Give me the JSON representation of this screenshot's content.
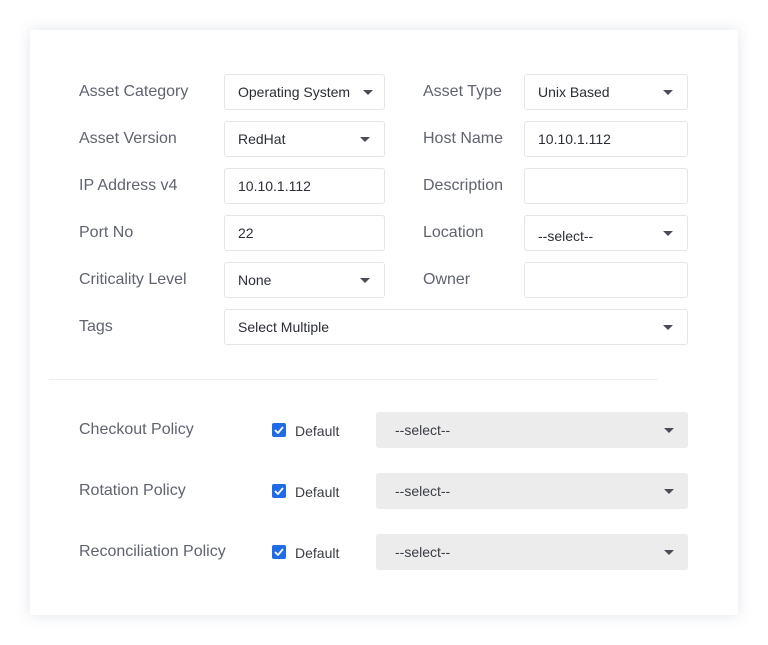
{
  "form": {
    "asset_category": {
      "label": "Asset Category",
      "value": "Operating System"
    },
    "asset_type": {
      "label": "Asset Type",
      "value": "Unix Based"
    },
    "asset_version": {
      "label": "Asset Version",
      "value": "RedHat"
    },
    "host_name": {
      "label": "Host Name",
      "value": "10.10.1.112"
    },
    "ip_address": {
      "label": "IP Address v4",
      "value": "10.10.1.112"
    },
    "description": {
      "label": "Description",
      "value": ""
    },
    "port_no": {
      "label": "Port No",
      "value": "22"
    },
    "location": {
      "label": "Location",
      "value": "--select--"
    },
    "criticality": {
      "label": "Criticality Level",
      "value": "None"
    },
    "owner": {
      "label": "Owner",
      "value": ""
    },
    "tags": {
      "label": "Tags",
      "value": "Select Multiple"
    }
  },
  "policies": [
    {
      "label": "Checkout Policy",
      "checkbox_label": "Default",
      "checked": true,
      "select_value": "--select--"
    },
    {
      "label": "Rotation Policy",
      "checkbox_label": "Default",
      "checked": true,
      "select_value": "--select--"
    },
    {
      "label": "Reconciliation Policy",
      "checkbox_label": "Default",
      "checked": true,
      "select_value": "--select--"
    }
  ],
  "colors": {
    "accent": "#1f6be8",
    "label": "#5f6370",
    "border": "#e3e5ea",
    "select_bg": "#ececed"
  }
}
